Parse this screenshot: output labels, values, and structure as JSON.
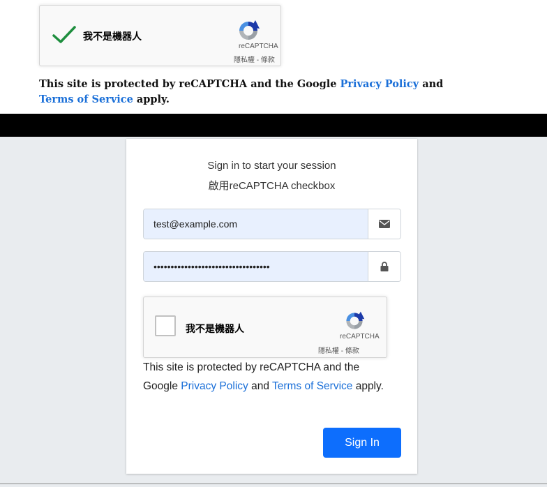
{
  "top_demo": {
    "recaptcha": {
      "label": "我不是機器人",
      "brand": "reCAPTCHA",
      "privacy": "隱私權",
      "separator": " - ",
      "terms": "條款",
      "checked": true
    },
    "notice": {
      "text1": "This site is protected by reCAPTCHA and the Google ",
      "privacy_link": "Privacy Policy",
      "text2": " and ",
      "terms_link": "Terms of Service",
      "text3": " apply."
    }
  },
  "login": {
    "message": "Sign in to start your session",
    "subtitle": "啟用reCAPTCHA checkbox",
    "email": {
      "value": "test@example.com",
      "icon": "envelope-icon"
    },
    "password": {
      "value": "••••••••••••••••••••••••••••••••••",
      "icon": "lock-icon"
    },
    "recaptcha": {
      "label": "我不是機器人",
      "brand": "reCAPTCHA",
      "privacy": "隱私權",
      "separator": " - ",
      "terms": "條款",
      "checked": false
    },
    "notice": {
      "text1": "This site is protected by reCAPTCHA and the Google ",
      "privacy_link": "Privacy Policy",
      "text2": " and ",
      "terms_link": "Terms of Service",
      "text3": " apply."
    },
    "signin_label": "Sign In"
  },
  "colors": {
    "accent": "#0d6efd",
    "link": "#1a6fd8",
    "page_bg": "#e9ecef",
    "autofill_bg": "#e8f0fe",
    "check_green": "#1e8e3e"
  }
}
